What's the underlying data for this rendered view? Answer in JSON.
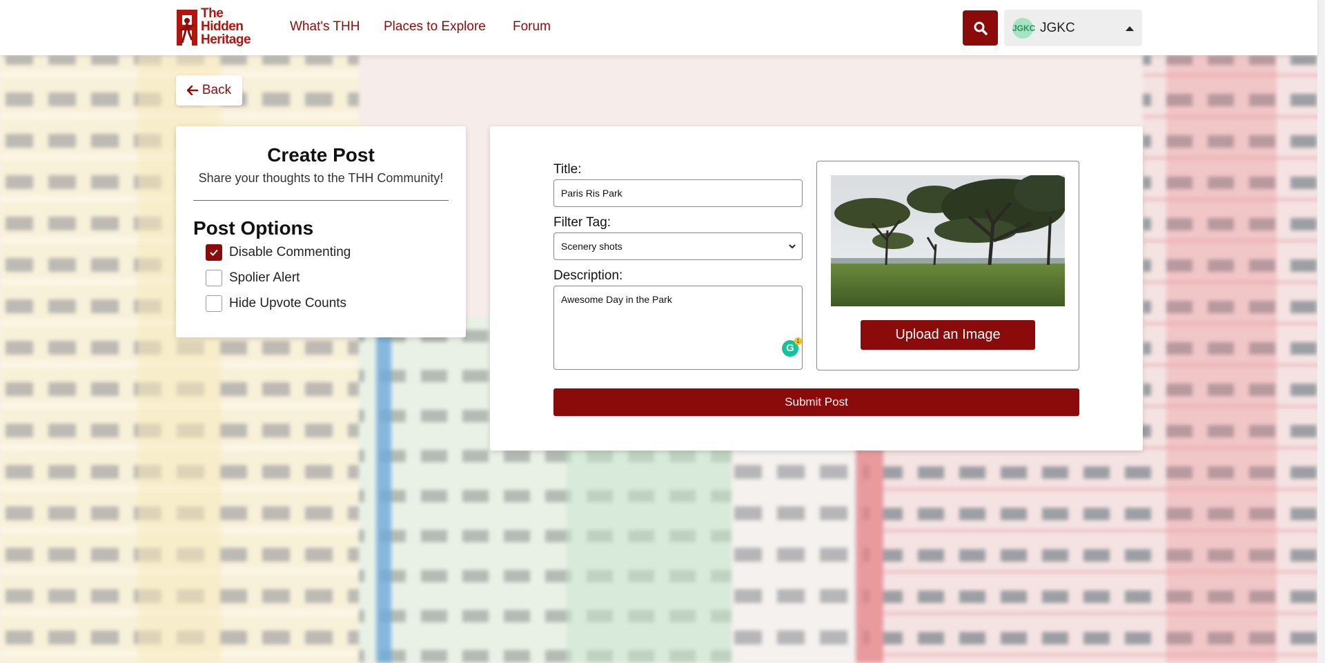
{
  "nav": {
    "logo_lines": [
      "The",
      "Hidden",
      "Heritage"
    ],
    "links": [
      "What's THH",
      "Places to Explore",
      "Forum"
    ],
    "search_icon": "search-icon",
    "user": {
      "avatar_text": "JGKC",
      "name": "JGKC"
    }
  },
  "back": {
    "label": "Back",
    "icon": "arrow-left-icon"
  },
  "create_post": {
    "title": "Create Post",
    "subtitle": "Share your thoughts to the THH Community!",
    "options_title": "Post Options",
    "options": [
      {
        "label": "Disable Commenting",
        "checked": true
      },
      {
        "label": "Spolier Alert",
        "checked": false
      },
      {
        "label": "Hide Upvote Counts",
        "checked": false
      }
    ]
  },
  "form": {
    "title_label": "Title:",
    "title_value": "Paris Ris Park",
    "tag_label": "Filter Tag:",
    "tag_value": "Scenery shots",
    "description_label": "Description:",
    "description_value": "Awesome Day in the Park",
    "grammarly_count": "1",
    "upload_label": "Upload an Image",
    "submit_label": "Submit Post"
  },
  "colors": {
    "brand": "#8b0b0b",
    "logo": "#b3140e"
  }
}
